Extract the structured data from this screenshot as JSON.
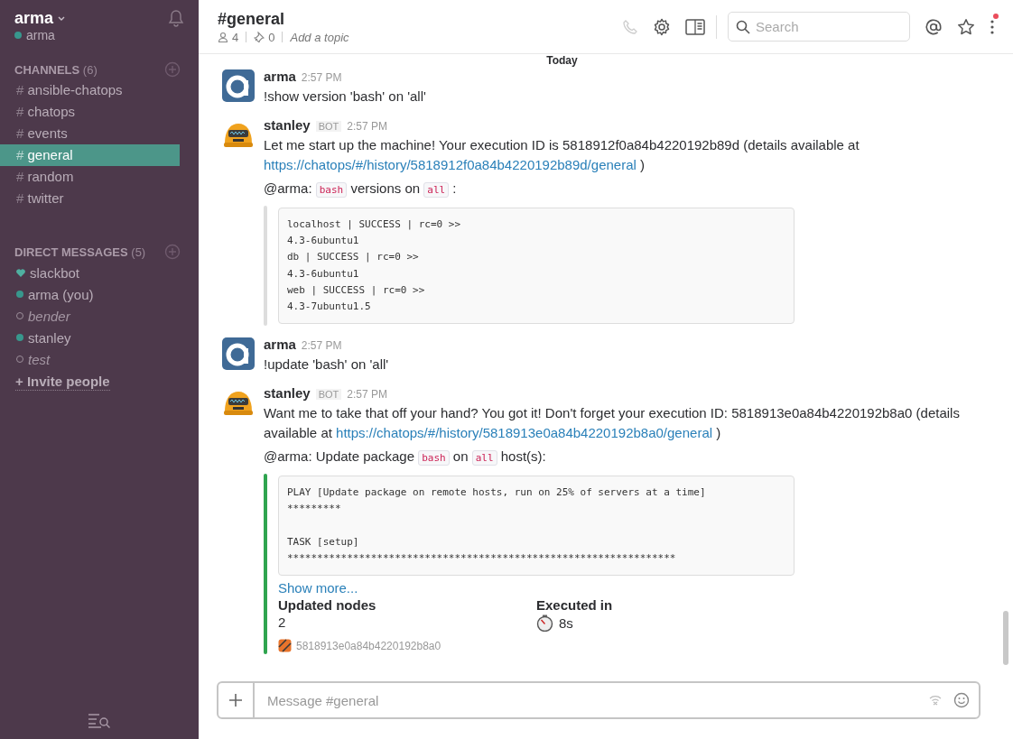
{
  "team": {
    "name": "arma",
    "user": "arma"
  },
  "channels": {
    "heading": "CHANNELS",
    "count": "(6)",
    "items": [
      {
        "symbol": "#",
        "name": "ansible-chatops",
        "selected": false
      },
      {
        "symbol": "#",
        "name": "chatops",
        "selected": false
      },
      {
        "symbol": "#",
        "name": "events",
        "selected": false
      },
      {
        "symbol": "#",
        "name": "general",
        "selected": true
      },
      {
        "symbol": "#",
        "name": "random",
        "selected": false
      },
      {
        "symbol": "#",
        "name": "twitter",
        "selected": false
      }
    ]
  },
  "direct_messages": {
    "heading": "DIRECT MESSAGES",
    "count": "(5)",
    "items": [
      {
        "name": "slackbot",
        "kind": "bot"
      },
      {
        "name": "arma (you)",
        "kind": "online"
      },
      {
        "name": "bender",
        "kind": "away"
      },
      {
        "name": "stanley",
        "kind": "online"
      },
      {
        "name": "test",
        "kind": "away"
      }
    ]
  },
  "invite": {
    "symbol": "+",
    "label": "Invite people"
  },
  "header": {
    "title": "#general",
    "members": "4",
    "pins": "0",
    "topic": "Add a topic",
    "search_placeholder": "Search",
    "unread": true
  },
  "day_divider": "Today",
  "messages": [
    {
      "author": "arma",
      "kind": "user",
      "time": "2:57 PM",
      "paragraphs": [
        [
          {
            "kind": "text",
            "text": "!show version 'bash' on 'all'"
          }
        ]
      ]
    },
    {
      "author": "stanley",
      "kind": "bot",
      "badge": "BOT",
      "time": "2:57 PM",
      "paragraphs": [
        [
          {
            "kind": "text",
            "text": "Let me start up the machine! Your execution ID is 5818912f0a84b4220192b89d (details available at"
          },
          {
            "kind": "link",
            "text": "https://chatops/#/history/5818912f0a84b4220192b89d/general"
          },
          {
            "kind": "text",
            "text": ")"
          }
        ],
        [
          {
            "kind": "text",
            "text": "@arma:"
          },
          {
            "kind": "code",
            "text": "bash"
          },
          {
            "kind": "text",
            "text": "versions on"
          },
          {
            "kind": "code",
            "text": "all"
          },
          {
            "kind": "text",
            "text": ":"
          }
        ]
      ],
      "attachment": {
        "color": "#dddddd",
        "code": "localhost | SUCCESS | rc=0 >>\n4.3-6ubuntu1\ndb | SUCCESS | rc=0 >>\n4.3-6ubuntu1\nweb | SUCCESS | rc=0 >>\n4.3-7ubuntu1.5"
      }
    },
    {
      "author": "arma",
      "kind": "user",
      "time": "2:57 PM",
      "paragraphs": [
        [
          {
            "kind": "text",
            "text": "!update 'bash' on 'all'"
          }
        ]
      ]
    },
    {
      "author": "stanley",
      "kind": "bot",
      "badge": "BOT",
      "time": "2:57 PM",
      "paragraphs": [
        [
          {
            "kind": "text",
            "text": "Want me to take that off your hand? You got it! Don't forget your execution ID: 5818913e0a84b4220192b8a0 (details available at"
          },
          {
            "kind": "link",
            "text": "https://chatops/#/history/5818913e0a84b4220192b8a0/general"
          },
          {
            "kind": "text",
            "text": ")"
          }
        ],
        [
          {
            "kind": "text",
            "text": "@arma: Update package"
          },
          {
            "kind": "code",
            "text": "bash"
          },
          {
            "kind": "text",
            "text": "on"
          },
          {
            "kind": "code",
            "text": "all"
          },
          {
            "kind": "text",
            "text": "host(s):"
          }
        ]
      ],
      "attachment": {
        "color": "#2fa44f",
        "code": "PLAY [Update package on remote hosts, run on 25% of servers at a time]\n*********\n\nTASK [setup]\n*****************************************************************",
        "show_more": "Show more...",
        "fields": [
          {
            "title": "Updated nodes",
            "value": "2",
            "kind": "count"
          },
          {
            "title": "Executed in",
            "value": "8s",
            "kind": "duration"
          }
        ],
        "footer": "5818913e0a84b4220192b8a0"
      }
    }
  ],
  "composer": {
    "placeholder": "Message #general"
  }
}
